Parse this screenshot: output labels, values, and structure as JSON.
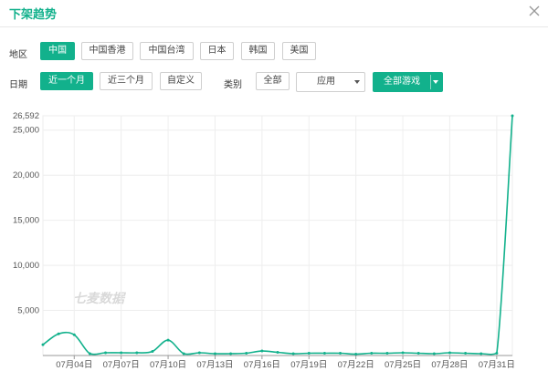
{
  "title": "下架趋势",
  "close_icon": "close-icon",
  "filters": {
    "region_label": "地区",
    "regions": [
      "中国",
      "中国香港",
      "中国台湾",
      "日本",
      "韩国",
      "美国"
    ],
    "region_selected": "中国",
    "date_label": "日期",
    "dates": [
      "近一个月",
      "近三个月",
      "自定义"
    ],
    "date_selected": "近一个月",
    "category_label": "类别",
    "category_all": "全部",
    "category_select_value": "应用",
    "games_select_value": "全部游戏"
  },
  "watermark": "七麦数据",
  "accent_color": "#12b18c",
  "chart_data": {
    "type": "line",
    "title": "",
    "xlabel": "",
    "ylabel": "",
    "ylim": [
      0,
      26592
    ],
    "y_ticks": [
      "5,000",
      "10,000",
      "15,000",
      "20,000",
      "25,000",
      "26,592"
    ],
    "x_tick_labels": [
      "07月04日",
      "07月07日",
      "07月10日",
      "07月13日",
      "07月16日",
      "07月19日",
      "07月22日",
      "07月25日",
      "07月28日",
      "07月31日"
    ],
    "x": [
      "07月02日",
      "07月03日",
      "07月04日",
      "07月05日",
      "07月06日",
      "07月07日",
      "07月08日",
      "07月09日",
      "07月10日",
      "07月11日",
      "07月12日",
      "07月13日",
      "07月14日",
      "07月15日",
      "07月16日",
      "07月17日",
      "07月18日",
      "07月19日",
      "07月20日",
      "07月21日",
      "07月22日",
      "07月23日",
      "07月24日",
      "07月25日",
      "07月26日",
      "07月27日",
      "07月28日",
      "07月29日",
      "07月30日",
      "07月31日",
      "08月01日"
    ],
    "series": [
      {
        "color": "#12b18c",
        "values": [
          1200,
          2400,
          2300,
          200,
          300,
          300,
          300,
          450,
          1700,
          200,
          300,
          200,
          200,
          250,
          500,
          350,
          200,
          250,
          250,
          250,
          150,
          250,
          250,
          300,
          250,
          200,
          300,
          250,
          200,
          250,
          26592
        ]
      }
    ],
    "grid": true
  }
}
